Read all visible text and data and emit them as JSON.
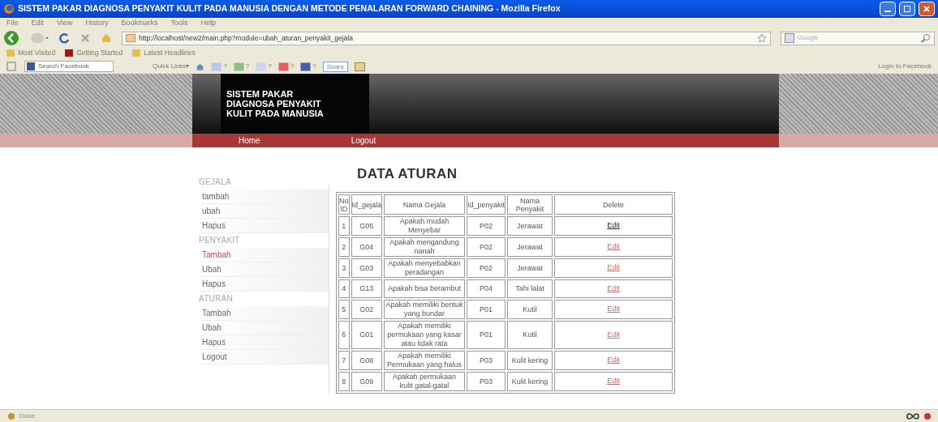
{
  "window": {
    "title": "SISTEM PAKAR DIAGNOSA PENYAKIT KULIT PADA MANUSIA DENGAN METODE PENALARAN FORWARD CHAINING - Mozilla Firefox"
  },
  "menu": [
    "File",
    "Edit",
    "View",
    "History",
    "Bookmarks",
    "Tools",
    "Help"
  ],
  "address": {
    "value": "http://localhost/new2/main.php?module=ubah_aturan_penyakit_gejala"
  },
  "search": {
    "placeholder": "Google"
  },
  "bookmarks": [
    "Most Visited",
    "Getting Started",
    "Latest Headlines"
  ],
  "fb_toolbar": {
    "search_placeholder": "Search Facebook",
    "quick_links": "Quick Links▾",
    "badges": [
      "?",
      "?",
      "?",
      "?",
      "?"
    ],
    "share": "Share",
    "login": "Login to Facebook"
  },
  "site": {
    "logo": [
      "SISTEM PAKAR",
      "DIAGNOSA PENYAKIT",
      "KULIT PADA MANUSIA"
    ],
    "nav": [
      "Home",
      "Logout"
    ]
  },
  "sidebar": [
    {
      "heading": "GEJALA",
      "items": [
        {
          "label": "tambah",
          "selected": false
        },
        {
          "label": "ubah",
          "selected": false
        },
        {
          "label": "Hapus",
          "selected": false
        }
      ]
    },
    {
      "heading": "PENYAKIT",
      "items": [
        {
          "label": "Tambah",
          "selected": true
        },
        {
          "label": "Ubah",
          "selected": false
        },
        {
          "label": "Hapus",
          "selected": false
        }
      ]
    },
    {
      "heading": "ATURAN",
      "items": [
        {
          "label": "Tambah",
          "selected": false
        },
        {
          "label": "Ubah",
          "selected": false
        },
        {
          "label": "Hapus",
          "selected": false
        },
        {
          "label": "Logout",
          "selected": false
        }
      ]
    }
  ],
  "page_title": "DATA ATURAN",
  "table": {
    "columns": [
      "No ID",
      "Id_gejala",
      "Nama Gejala",
      "Id_penyakit",
      "Nama Penyakit",
      "Delete"
    ],
    "rows": [
      {
        "no": "1",
        "id_gejala": "G05",
        "nama_gejala": "Apakah mudah Menyebar",
        "id_penyakit": "P02",
        "nama_penyakit": "Jerawat",
        "action": "Edit",
        "visited": false
      },
      {
        "no": "2",
        "id_gejala": "G04",
        "nama_gejala": "Apakah mengandung nanah",
        "id_penyakit": "P02",
        "nama_penyakit": "Jerawat",
        "action": "Edit",
        "visited": true
      },
      {
        "no": "3",
        "id_gejala": "G03",
        "nama_gejala": "Apakah menyebabkan peradangan",
        "id_penyakit": "P02",
        "nama_penyakit": "Jerawat",
        "action": "Edit",
        "visited": true
      },
      {
        "no": "4",
        "id_gejala": "G13",
        "nama_gejala": "Apakah bisa berambut",
        "id_penyakit": "P04",
        "nama_penyakit": "Tahi lalat",
        "action": "Edit",
        "visited": true
      },
      {
        "no": "5",
        "id_gejala": "G02",
        "nama_gejala": "Apakah memiliki bentuk yang bundar",
        "id_penyakit": "P01",
        "nama_penyakit": "Kutil",
        "action": "Edit",
        "visited": true
      },
      {
        "no": "6",
        "id_gejala": "G01",
        "nama_gejala": "Apakah memiliki permukaan yang kasar atau tidak rata",
        "id_penyakit": "P01",
        "nama_penyakit": "Kutil",
        "action": "Edit",
        "visited": true
      },
      {
        "no": "7",
        "id_gejala": "G08",
        "nama_gejala": "Apakah memiliki Permukaan yang halus",
        "id_penyakit": "P03",
        "nama_penyakit": "Kulit kering",
        "action": "Edit",
        "visited": true
      },
      {
        "no": "8",
        "id_gejala": "G09",
        "nama_gejala": "Apakah permukaan kulit gatal-gatal",
        "id_penyakit": "P03",
        "nama_penyakit": "Kulit kering",
        "action": "Edit",
        "visited": true
      }
    ]
  },
  "status_bar": "Done"
}
